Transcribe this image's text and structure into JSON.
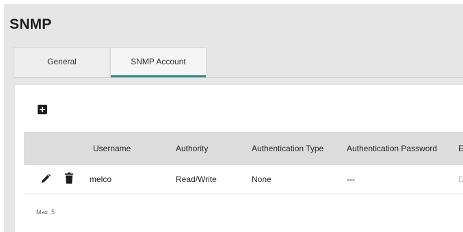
{
  "page": {
    "title": "SNMP"
  },
  "tabs": [
    {
      "label": "General",
      "active": false
    },
    {
      "label": "SNMP Account",
      "active": true
    }
  ],
  "toolbar": {
    "add_icon": "add-box-icon"
  },
  "table": {
    "columns": [
      "Username",
      "Authority",
      "Authentication Type",
      "Authentication Password",
      "E"
    ],
    "rows": [
      {
        "actions": [
          "edit-pencil-icon",
          "delete-trash-icon"
        ],
        "username": "melco",
        "authority": "Read/Write",
        "auth_type": "None",
        "auth_password": "---",
        "extra": "D"
      }
    ]
  },
  "footer": {
    "max_note": "Max. 5"
  },
  "colors": {
    "accent": "#2e8b83",
    "header_bg": "#dcdcdc",
    "page_bg": "#e6e6e6"
  }
}
